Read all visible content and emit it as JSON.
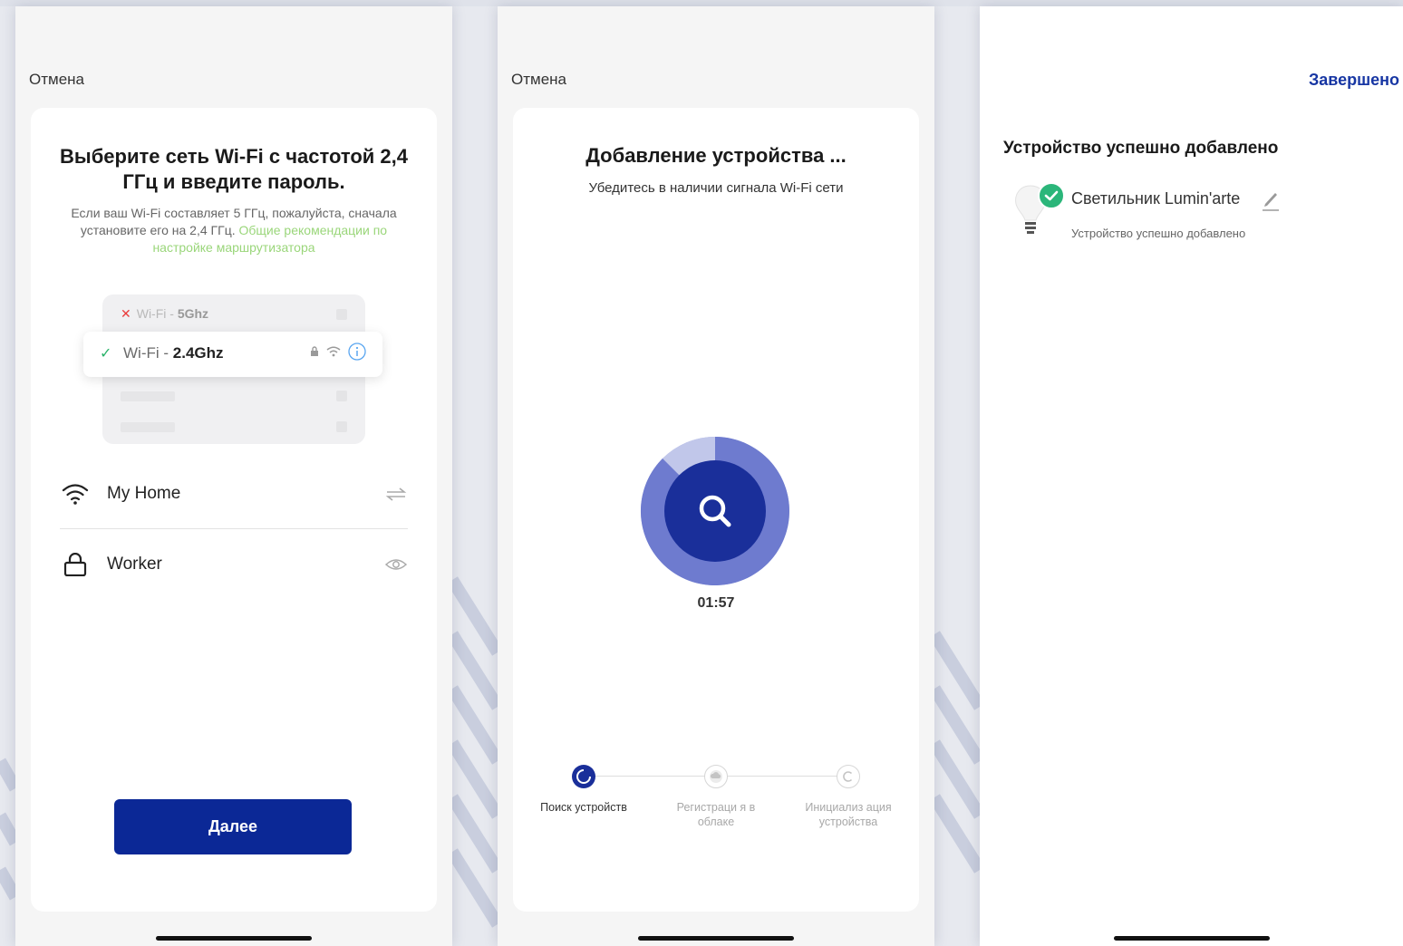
{
  "wifi_screen": {
    "cancel": "Отмена",
    "title": "Выберите сеть Wi-Fi с частотой 2,4 ГГц и введите пароль.",
    "description": "Если ваш Wi-Fi составляет 5 ГГц, пожалуйста, сначала установите его на 2,4 ГГц.",
    "description_link": "Общие рекомендации по настройке маршрутизатора",
    "illustration": {
      "bad_network_prefix": "Wi-Fi - ",
      "bad_network_band": "5Ghz",
      "good_network_prefix": "Wi-Fi - ",
      "good_network_band": "2.4Ghz"
    },
    "network_name": "My Home",
    "password": "Worker",
    "next_button": "Далее"
  },
  "search_screen": {
    "cancel": "Отмена",
    "title": "Добавление устройства ...",
    "subtitle": "Убедитесь в наличии сигнала Wi-Fi сети",
    "timer": "01:57",
    "steps": [
      {
        "label": "Поиск устройств",
        "state": "active"
      },
      {
        "label": "Регистраци я в облаке",
        "state": "pending"
      },
      {
        "label": "Инициализ ация устройства",
        "state": "pending"
      }
    ]
  },
  "done_screen": {
    "done": "Завершено",
    "heading": "Устройство успешно добавлено",
    "device_name": "Светильник Lumin'arte",
    "device_status": "Устройство успешно добавлено"
  },
  "colors": {
    "primary": "#0b2896",
    "accent_link": "#9ad67a",
    "success": "#2bb67a",
    "done_link": "#1736a3"
  }
}
